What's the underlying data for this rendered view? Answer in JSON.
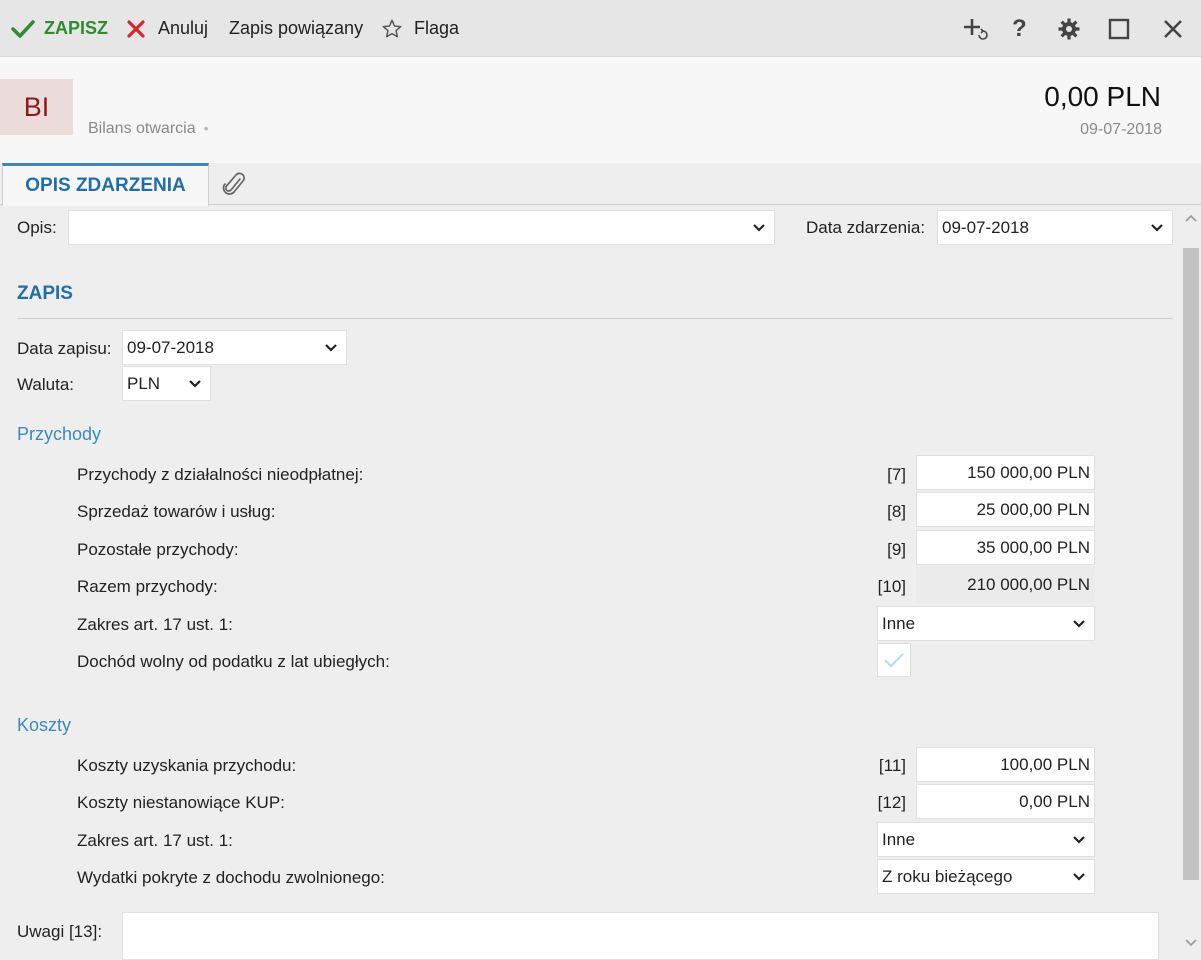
{
  "toolbar": {
    "save_label": "ZAPISZ",
    "cancel_label": "Anuluj",
    "linked_label": "Zapis powiązany",
    "flag_label": "Flaga",
    "help_symbol": "?"
  },
  "header": {
    "badge": "BI",
    "subtitle": "Bilans otwarcia",
    "amount": "0,00 PLN",
    "date": "09-07-2018"
  },
  "tabs": {
    "main": "OPIS ZDARZENIA"
  },
  "form": {
    "opis_label": "Opis:",
    "opis_value": "",
    "event_date_label": "Data zdarzenia:",
    "event_date_value": "09-07-2018",
    "section_title": "ZAPIS",
    "record_date_label": "Data zapisu:",
    "record_date_value": "09-07-2018",
    "currency_label": "Waluta:",
    "currency_value": "PLN"
  },
  "income": {
    "title": "Przychody",
    "rows": [
      {
        "label": "Przychody z działalności nieodpłatnej:",
        "code": "[7]",
        "value": "150 000,00 PLN"
      },
      {
        "label": "Sprzedaż towarów i usług:",
        "code": "[8]",
        "value": "25 000,00 PLN"
      },
      {
        "label": "Pozostałe przychody:",
        "code": "[9]",
        "value": "35 000,00 PLN"
      },
      {
        "label": "Razem przychody:",
        "code": "[10]",
        "value": "210 000,00 PLN"
      }
    ],
    "scope_label": "Zakres art. 17 ust. 1:",
    "scope_value": "Inne",
    "exempt_label": "Dochód wolny od podatku z lat ubiegłych:"
  },
  "costs": {
    "title": "Koszty",
    "rows": [
      {
        "label": "Koszty uzyskania przychodu:",
        "code": "[11]",
        "value": "100,00 PLN"
      },
      {
        "label": "Koszty niestanowiące KUP:",
        "code": "[12]",
        "value": "0,00 PLN"
      }
    ],
    "scope_label": "Zakres art. 17 ust. 1:",
    "scope_value": "Inne",
    "expenses_label": "Wydatki pokryte z dochodu zwolnionego:",
    "expenses_value": "Z roku bieżącego"
  },
  "notes": {
    "label": "Uwagi [13]:",
    "value": ""
  },
  "colors": {
    "save_green": "#2e8b2e",
    "cancel_red": "#d9262b",
    "accent_blue": "#2070a8",
    "badge_bg": "#ecdcdc",
    "badge_text": "#8c1a1a"
  },
  "icons": [
    "check-icon",
    "x-icon",
    "star-icon",
    "add-related-icon",
    "help-icon",
    "gear-icon",
    "maximize-icon",
    "close-icon",
    "paperclip-icon",
    "chevron-down-icon"
  ]
}
